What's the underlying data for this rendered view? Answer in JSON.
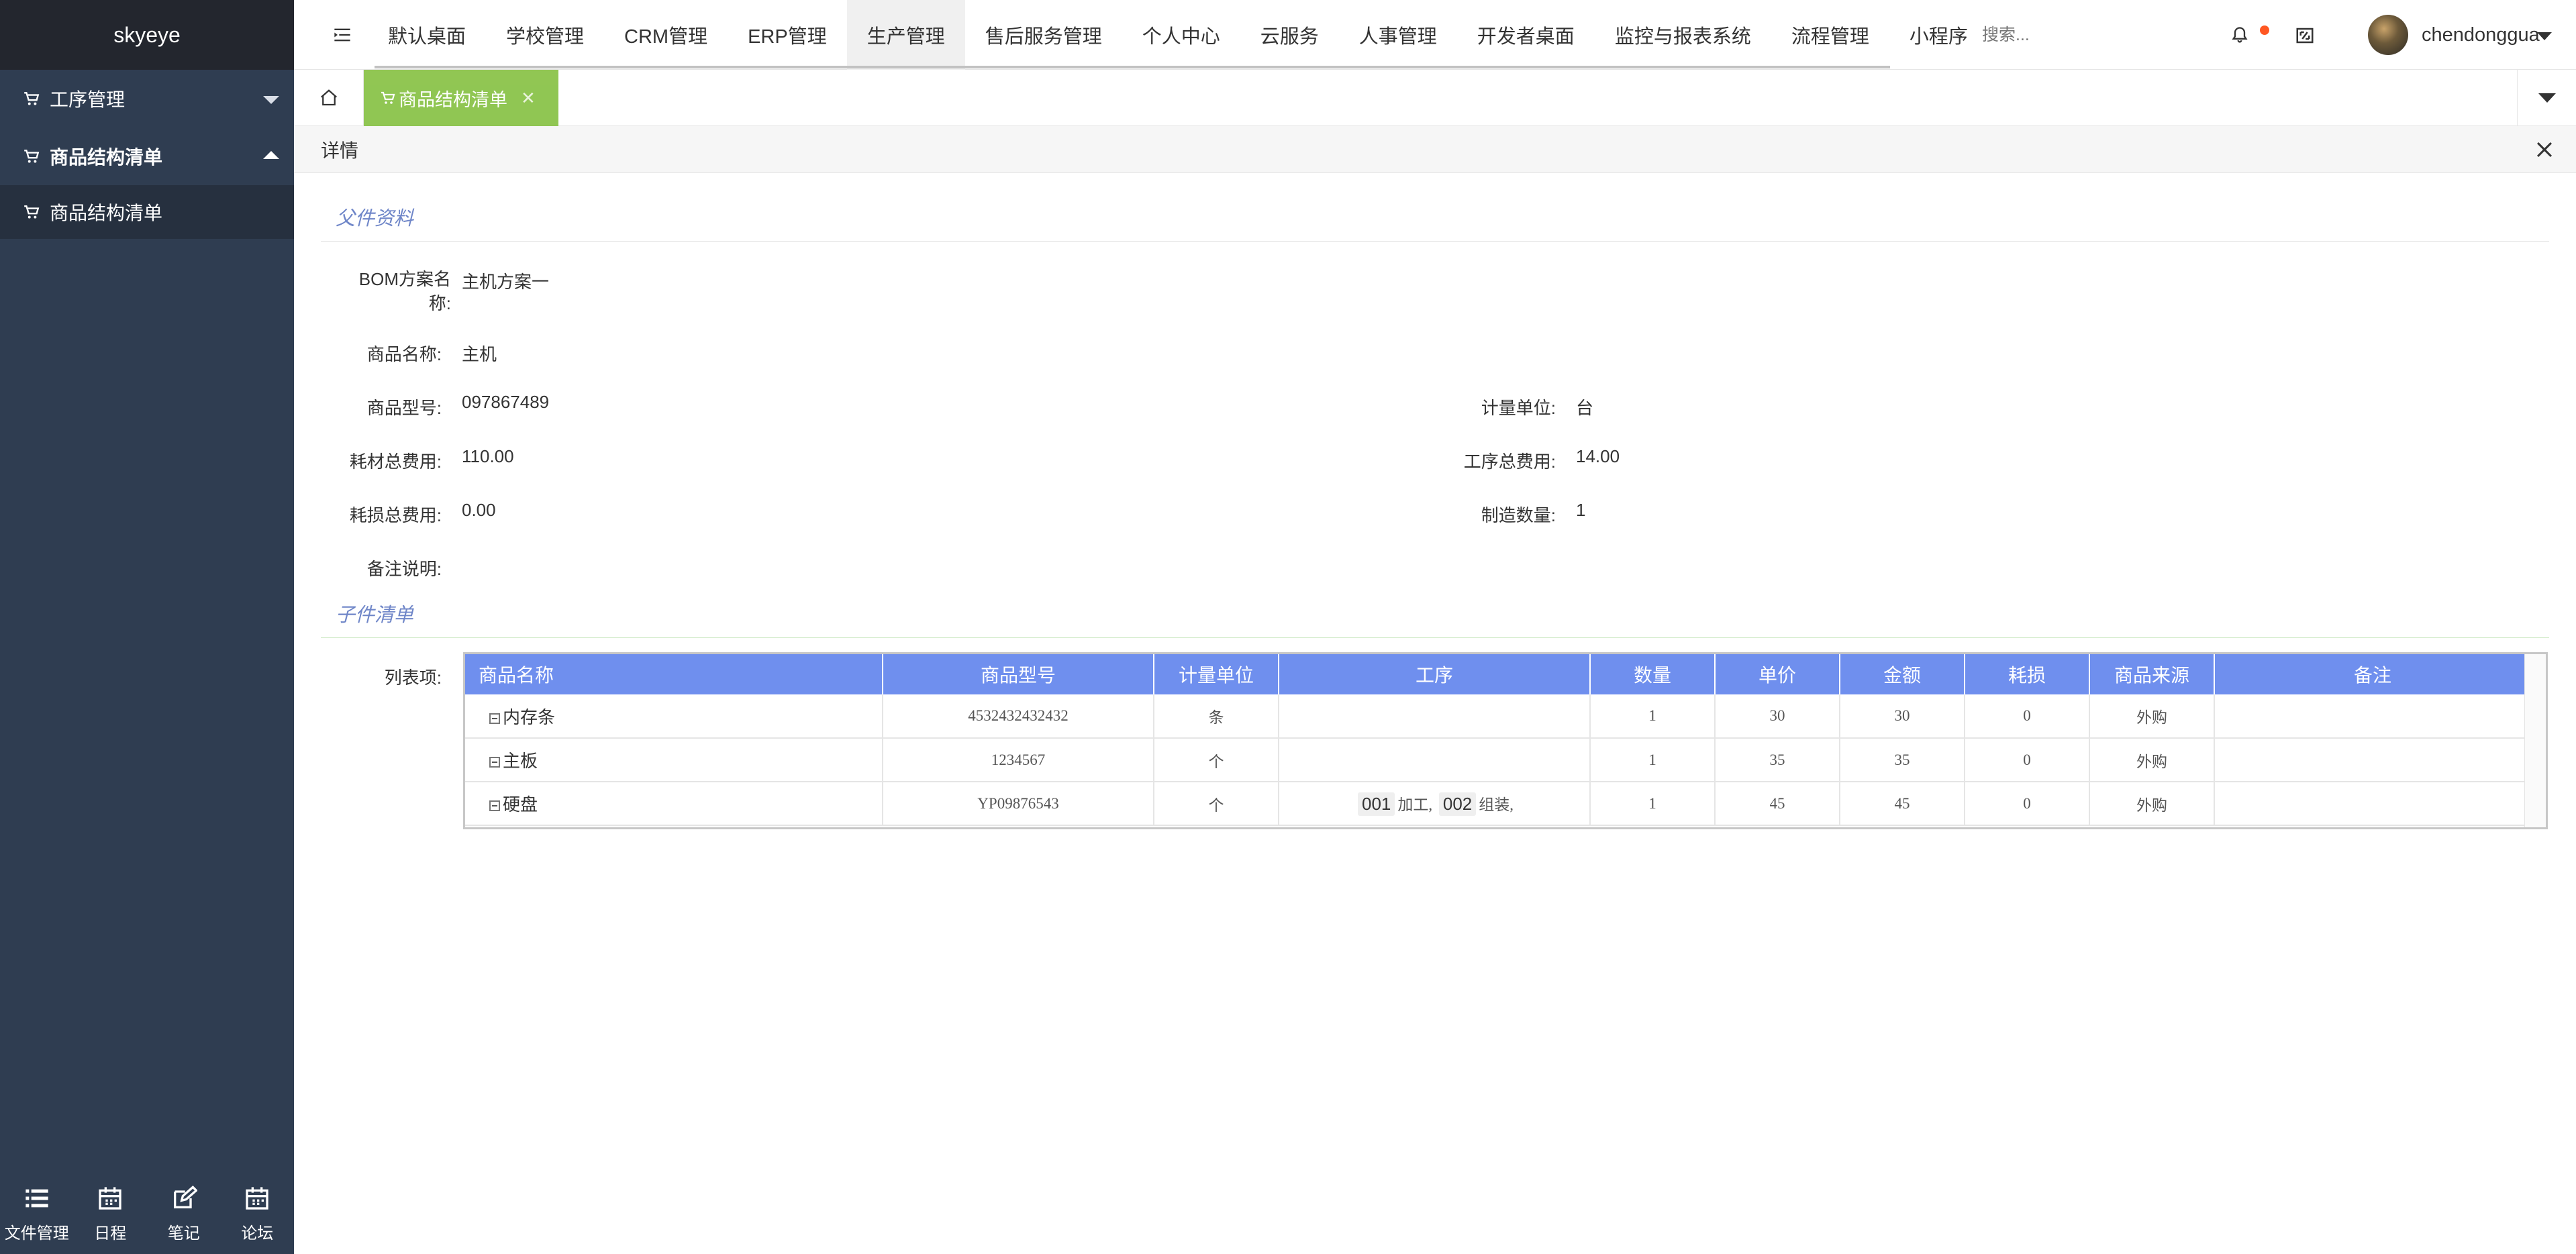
{
  "app": {
    "brand": "skyeye"
  },
  "sidebar": {
    "items": [
      {
        "label": "工序管理",
        "expanded": false
      },
      {
        "label": "商品结构清单",
        "expanded": true
      },
      {
        "label": "商品结构清单",
        "sub": true
      }
    ],
    "bottom": [
      {
        "label": "文件管理",
        "icon": "list-icon"
      },
      {
        "label": "日程",
        "icon": "calendar-icon"
      },
      {
        "label": "笔记",
        "icon": "edit-icon"
      },
      {
        "label": "论坛",
        "icon": "calendar-icon"
      }
    ]
  },
  "nav": {
    "items": [
      "默认桌面",
      "学校管理",
      "CRM管理",
      "ERP管理",
      "生产管理",
      "售后服务管理",
      "个人中心",
      "云服务",
      "人事管理",
      "开发者桌面",
      "监控与报表系统",
      "流程管理",
      "小程序"
    ],
    "active_index": 4,
    "search_placeholder": "搜索...",
    "username": "chendonggua"
  },
  "tabs": {
    "current": "商品结构清单",
    "close": "✕"
  },
  "panel": {
    "title": "详情"
  },
  "parent": {
    "section_title": "父件资料",
    "bom_label_line1": "BOM方案名",
    "bom_label_line2": "称:",
    "bom_value": "主机方案一",
    "name_label": "商品名称:",
    "name_value": "主机",
    "model_label": "商品型号:",
    "model_value": "097867489",
    "unit_label": "计量单位:",
    "unit_value": "台",
    "material_fee_label": "耗材总费用:",
    "material_fee_value": "110.00",
    "process_fee_label": "工序总费用:",
    "process_fee_value": "14.00",
    "loss_fee_label": "耗损总费用:",
    "loss_fee_value": "0.00",
    "quantity_label": "制造数量:",
    "quantity_value": "1",
    "remark_label": "备注说明:",
    "remark_value": ""
  },
  "children": {
    "section_title": "子件清单",
    "list_label": "列表项:",
    "columns": [
      "商品名称",
      "商品型号",
      "计量单位",
      "工序",
      "数量",
      "单价",
      "金额",
      "耗损",
      "商品来源",
      "备注"
    ],
    "rows": [
      {
        "name": "内存条",
        "model": "4532432432432",
        "unit": "条",
        "process": [],
        "qty": "1",
        "price": "30",
        "amount": "30",
        "loss": "0",
        "source": "外购",
        "remark": ""
      },
      {
        "name": "主板",
        "model": "1234567",
        "unit": "个",
        "process": [],
        "qty": "1",
        "price": "35",
        "amount": "35",
        "loss": "0",
        "source": "外购",
        "remark": ""
      },
      {
        "name": "硬盘",
        "model": "YP09876543",
        "unit": "个",
        "process": [
          {
            "code": "001",
            "name": "加工,"
          },
          {
            "code": "002",
            "name": "组装,"
          }
        ],
        "qty": "1",
        "price": "45",
        "amount": "45",
        "loss": "0",
        "source": "外购",
        "remark": ""
      }
    ]
  },
  "colors": {
    "sidebar": "#2f3d51",
    "brand_bar": "#23262e",
    "tab_active": "#8bc34a",
    "table_header": "#6f8fee",
    "section_title": "#6f86c8"
  }
}
